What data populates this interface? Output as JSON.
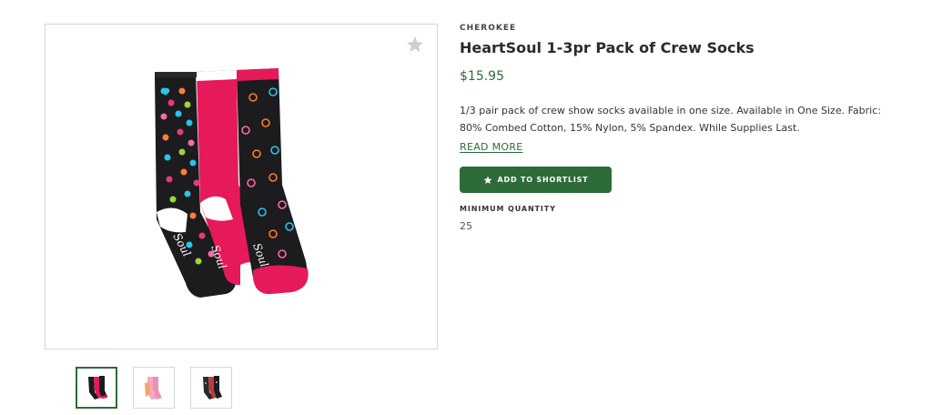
{
  "product": {
    "brand": "CHEROKEE",
    "title": "HeartSoul 1-3pr Pack of Crew Socks",
    "price": "$15.95",
    "description": "1/3 pair pack of crew show socks available in one size. Available in One Size. Fabric: 80% Combed Cotton, 15% Nylon, 5% Spandex. While Supplies Last.",
    "read_more": "READ MORE",
    "shortlist_button": "ADD TO SHORTLIST",
    "min_quantity_label": "MINIMUM QUANTITY",
    "min_quantity_value": "25"
  },
  "gallery": {
    "favorite_icon": "star-icon",
    "thumbnails": [
      "socks-black-pink",
      "socks-pink-peach",
      "socks-dark-pattern"
    ],
    "active_index": 0
  },
  "colors": {
    "accent": "#2e6b3a",
    "sock_black": "#1c1b1e",
    "sock_pink": "#e6195a"
  }
}
